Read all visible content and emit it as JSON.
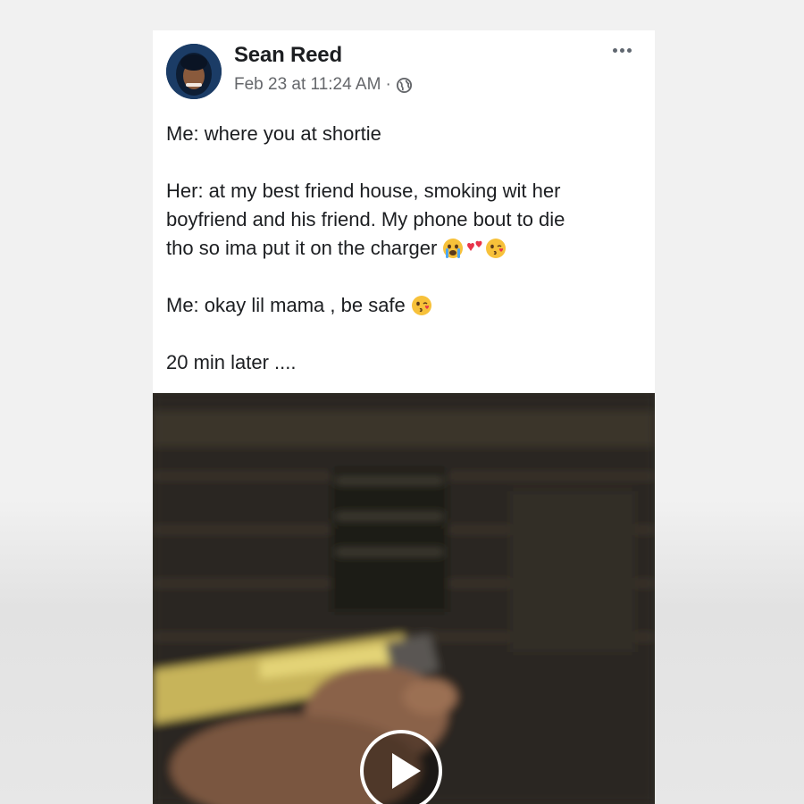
{
  "post": {
    "author": "Sean Reed",
    "timestamp": "Feb 23 at 11:24 AM",
    "separator": "·",
    "privacy_icon": "globe-icon",
    "more_icon": "more-options-icon",
    "lines": [
      {
        "text": "Me: where you at shortie",
        "emojis": []
      },
      {
        "text": "",
        "emojis": []
      },
      {
        "text": "Her: at my best friend house, smoking  wit her",
        "emojis": []
      },
      {
        "text": "boyfriend and his friend. My phone bout to die",
        "emojis": []
      },
      {
        "text": "tho so ima put it on the charger ",
        "emojis": [
          "crying-face-emoji",
          "two-hearts-emoji",
          "kissing-face-emoji"
        ]
      },
      {
        "text": "",
        "emojis": []
      },
      {
        "text": "Me: okay lil mama , be safe ",
        "emojis": [
          "kissing-face-emoji"
        ]
      },
      {
        "text": "",
        "emojis": []
      },
      {
        "text": "20 min later ....",
        "emojis": []
      }
    ],
    "video": {
      "play_icon": "play-icon"
    }
  },
  "colors": {
    "name": "#1c1e21",
    "meta": "#65676b",
    "card": "#ffffff",
    "page_bg": "#f1f1f1"
  }
}
